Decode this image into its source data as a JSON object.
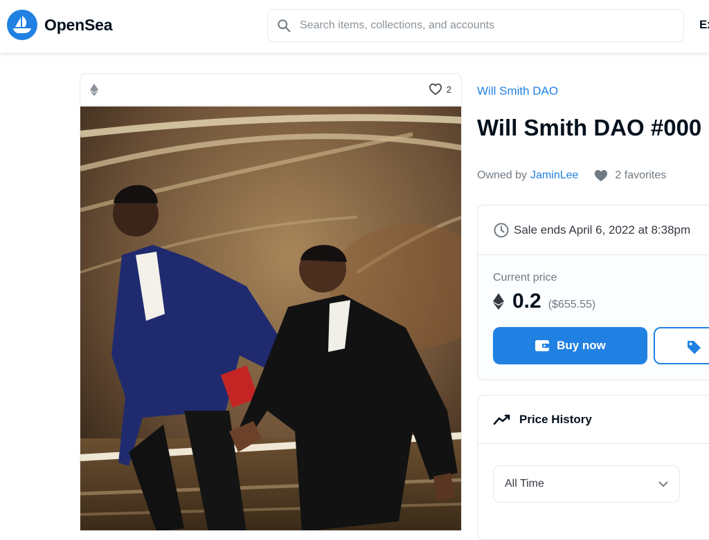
{
  "header": {
    "brand": "OpenSea",
    "search_placeholder": "Search items, collections, and accounts",
    "nav_explore": "Explore"
  },
  "card": {
    "favorites_count": "2",
    "chain_icon": "ethereum-icon",
    "image_icon": "nft-artwork"
  },
  "item": {
    "collection": "Will Smith DAO",
    "title": "Will Smith DAO #000",
    "owned_by_label": "Owned by",
    "owner": "JaminLee",
    "favorites": "2 favorites"
  },
  "sale": {
    "ends_text": "Sale ends April 6, 2022 at 8:38pm",
    "current_price_label": "Current price",
    "price_eth": "0.2",
    "price_usd": "($655.55)",
    "buy_label": "Buy now"
  },
  "history": {
    "title": "Price History",
    "period": "All Time"
  },
  "colors": {
    "accent": "#2081e2",
    "text_dark": "#04111d",
    "text_muted": "#707a83",
    "border": "#e5e8eb"
  }
}
